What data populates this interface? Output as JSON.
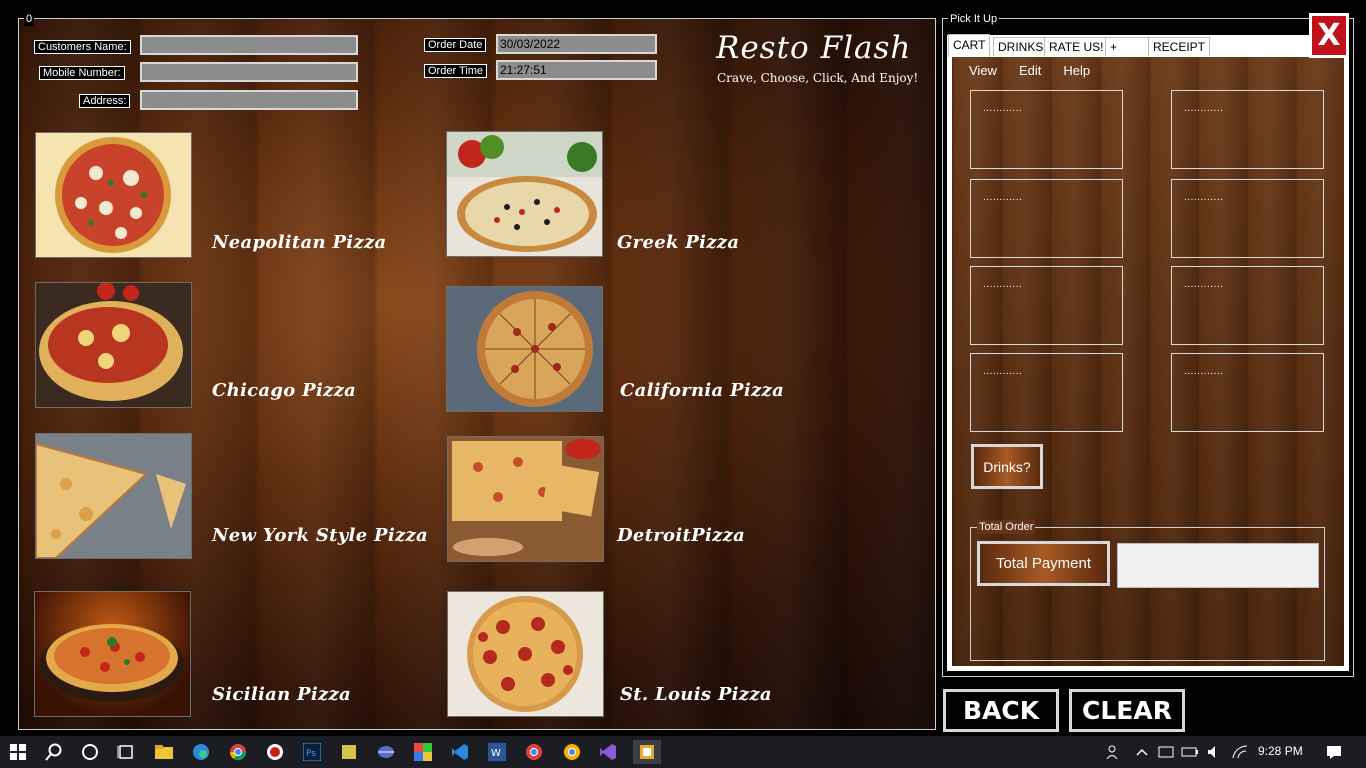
{
  "form": {
    "main_group_label": "0",
    "fields": {
      "customer_name_label": "Customers Name:",
      "customer_name_value": "",
      "mobile_label": "Mobile Number:",
      "mobile_value": "",
      "address_label": "Address:",
      "address_value": "",
      "order_date_label": "Order Date",
      "order_date_value": "30/03/2022",
      "order_time_label": "Order Time",
      "order_time_value": "21:27:51"
    },
    "brand": {
      "title": "Resto Flash",
      "tagline": "Crave, Choose, Click, And Enjoy!"
    },
    "pizzas": [
      {
        "name": "Neapolitan Pizza"
      },
      {
        "name": "Greek Pizza"
      },
      {
        "name": "Chicago Pizza"
      },
      {
        "name": "California Pizza"
      },
      {
        "name": "New York Style Pizza"
      },
      {
        "name": "DetroitPizza"
      },
      {
        "name": "Sicilian Pizza"
      },
      {
        "name": "St. Louis Pizza"
      }
    ]
  },
  "pick_panel": {
    "group_label": "Pick It Up",
    "tabs": [
      {
        "label": "CART"
      },
      {
        "label": "DRINKS"
      },
      {
        "label": "RATE US!"
      },
      {
        "label": "+"
      },
      {
        "label": "RECEIPT"
      }
    ],
    "menu": [
      {
        "label": "View"
      },
      {
        "label": "Edit"
      },
      {
        "label": "Help"
      }
    ],
    "slots": [
      {
        "text": "............"
      },
      {
        "text": "............"
      },
      {
        "text": "............"
      },
      {
        "text": "............"
      },
      {
        "text": "............"
      },
      {
        "text": "............"
      },
      {
        "text": "............"
      },
      {
        "text": "............"
      }
    ],
    "drinks_button": "Drinks?",
    "total_group_label": "Total Order",
    "total_payment_button": "Total Payment",
    "total_value": ""
  },
  "actions": {
    "close_label": "X",
    "back_label": "BACK",
    "clear_label": "CLEAR"
  },
  "taskbar": {
    "clock": "9:28 PM",
    "icons": [
      "windows-icon",
      "search-icon",
      "cortana-icon",
      "task-view-icon",
      "file-explorer-icon",
      "edge-icon",
      "chrome-icon",
      "record-icon",
      "photoshop-icon",
      "app-icon",
      "netbeans-icon",
      "winrar-icon",
      "vscode-icon",
      "word-icon",
      "chrome-icon",
      "chrome-icon",
      "visual-studio-icon",
      "app-icon"
    ]
  }
}
